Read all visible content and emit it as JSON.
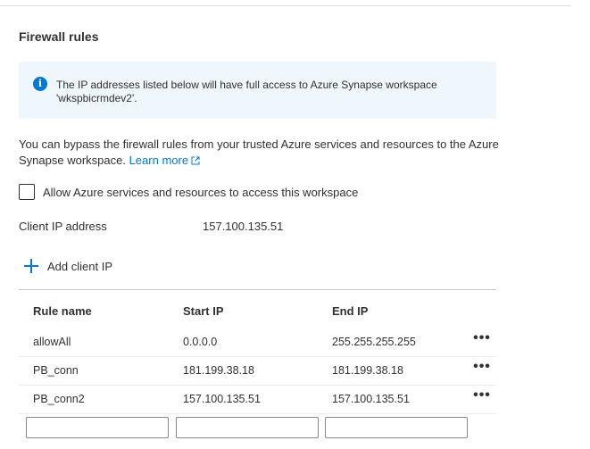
{
  "section": {
    "title": "Firewall rules"
  },
  "info": {
    "icon": "info-icon",
    "text": "The IP addresses listed below will have full access to Azure Synapse workspace 'wkspbicrmdev2'."
  },
  "bypass": {
    "text": "You can bypass the firewall rules from your trusted Azure services and resources to the Azure Synapse workspace.",
    "learn_more": "Learn more"
  },
  "allow_checkbox": {
    "label": "Allow Azure services and resources to access this workspace",
    "checked": false
  },
  "client_ip": {
    "label": "Client IP address",
    "value": "157.100.135.51"
  },
  "add_client": {
    "label": "Add client IP"
  },
  "table": {
    "headers": {
      "rule_name": "Rule name",
      "start_ip": "Start IP",
      "end_ip": "End IP"
    },
    "rows": [
      {
        "rule_name": "allowAll",
        "start_ip": "0.0.0.0",
        "end_ip": "255.255.255.255",
        "more": "•••"
      },
      {
        "rule_name": "PB_conn",
        "start_ip": "181.199.38.18",
        "end_ip": "181.199.38.18",
        "more": "•••"
      },
      {
        "rule_name": "PB_conn2",
        "start_ip": "157.100.135.51",
        "end_ip": "157.100.135.51",
        "more": "•••"
      }
    ],
    "new_row": {
      "rule_name": "",
      "start_ip": "",
      "end_ip": ""
    }
  },
  "colors": {
    "accent": "#0078d4",
    "info_bg": "#eff6fc"
  }
}
